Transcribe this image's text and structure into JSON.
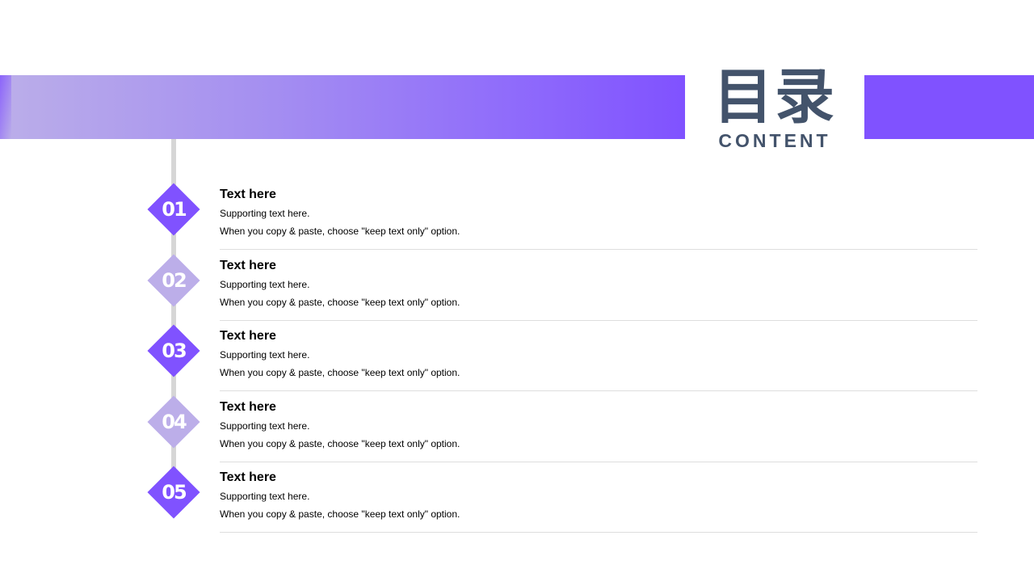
{
  "header": {
    "title_cn": "目录",
    "title_en": "CONTENT"
  },
  "colors": {
    "accent": "#8052ff",
    "accent_light": "#bcaee9",
    "title": "#43536b"
  },
  "items": [
    {
      "number": "01",
      "title": "Text here",
      "subtitle": "Supporting text here.",
      "note": "When you copy & paste, choose \"keep text only\" option.",
      "shade": "dark"
    },
    {
      "number": "02",
      "title": "Text here",
      "subtitle": "Supporting text here.",
      "note": "When you copy & paste, choose \"keep text only\" option.",
      "shade": "light"
    },
    {
      "number": "03",
      "title": "Text here",
      "subtitle": "Supporting text here.",
      "note": "When you copy & paste, choose \"keep text only\" option.",
      "shade": "dark"
    },
    {
      "number": "04",
      "title": "Text here",
      "subtitle": "Supporting text here.",
      "note": "When you copy & paste, choose \"keep text only\" option.",
      "shade": "light"
    },
    {
      "number": "05",
      "title": "Text here",
      "subtitle": "Supporting text here.",
      "note": "When you copy & paste, choose \"keep text only\" option.",
      "shade": "dark"
    }
  ]
}
